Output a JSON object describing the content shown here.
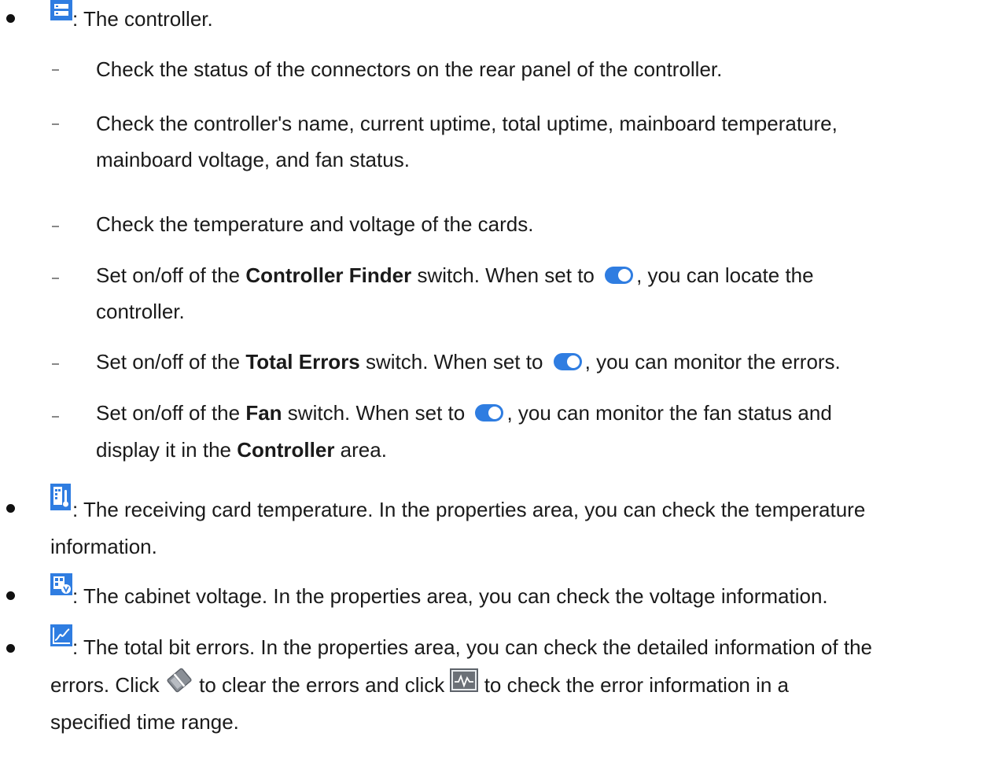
{
  "items": {
    "controller": {
      "desc": ": The controller.",
      "sub1": "Check the status of the connectors on the rear panel of the controller.",
      "sub2_l1": "Check the controller's name, current uptime, total uptime, mainboard temperature,",
      "sub2_l2": "mainboard voltage, and fan status.",
      "sub3": "Check the temperature and voltage of the cards.",
      "sub4_a": "Set on/off of the ",
      "sub4_b": "Controller Finder",
      "sub4_c": " switch. When set to ",
      "sub4_d": ", you can locate the",
      "sub4_l2": "controller.",
      "sub5_a": "Set on/off of the ",
      "sub5_b": "Total Errors",
      "sub5_c": " switch. When set to ",
      "sub5_d": ", you can monitor the errors.",
      "sub6_a": "Set on/off of the ",
      "sub6_b": "Fan",
      "sub6_c": " switch. When set to ",
      "sub6_d": ", you can monitor the fan status and",
      "sub6_l2_a": "display it in the ",
      "sub6_l2_b": "Controller",
      "sub6_l2_c": " area."
    },
    "temperature": {
      "l1": ": The receiving card temperature. In the properties area, you can check the temperature",
      "l2": "information."
    },
    "voltage": {
      "l1": ": The cabinet voltage. In the properties area, you can check the voltage information."
    },
    "errors": {
      "l1": ": The total bit errors. In the properties area, you can check the detailed information of the",
      "l2_a": "errors. Click ",
      "l2_b": " to clear the errors and click ",
      "l2_c": " to check the error information in a",
      "l3": "specified time range."
    }
  },
  "icons": {
    "controller": "controller-icon",
    "temperature": "thermometer-card-icon",
    "voltage": "voltage-card-icon",
    "errors": "line-chart-icon",
    "clear": "eraser-icon",
    "history": "waveform-icon",
    "toggle": "toggle-on-icon"
  },
  "colors": {
    "accent": "#2f7de1"
  }
}
